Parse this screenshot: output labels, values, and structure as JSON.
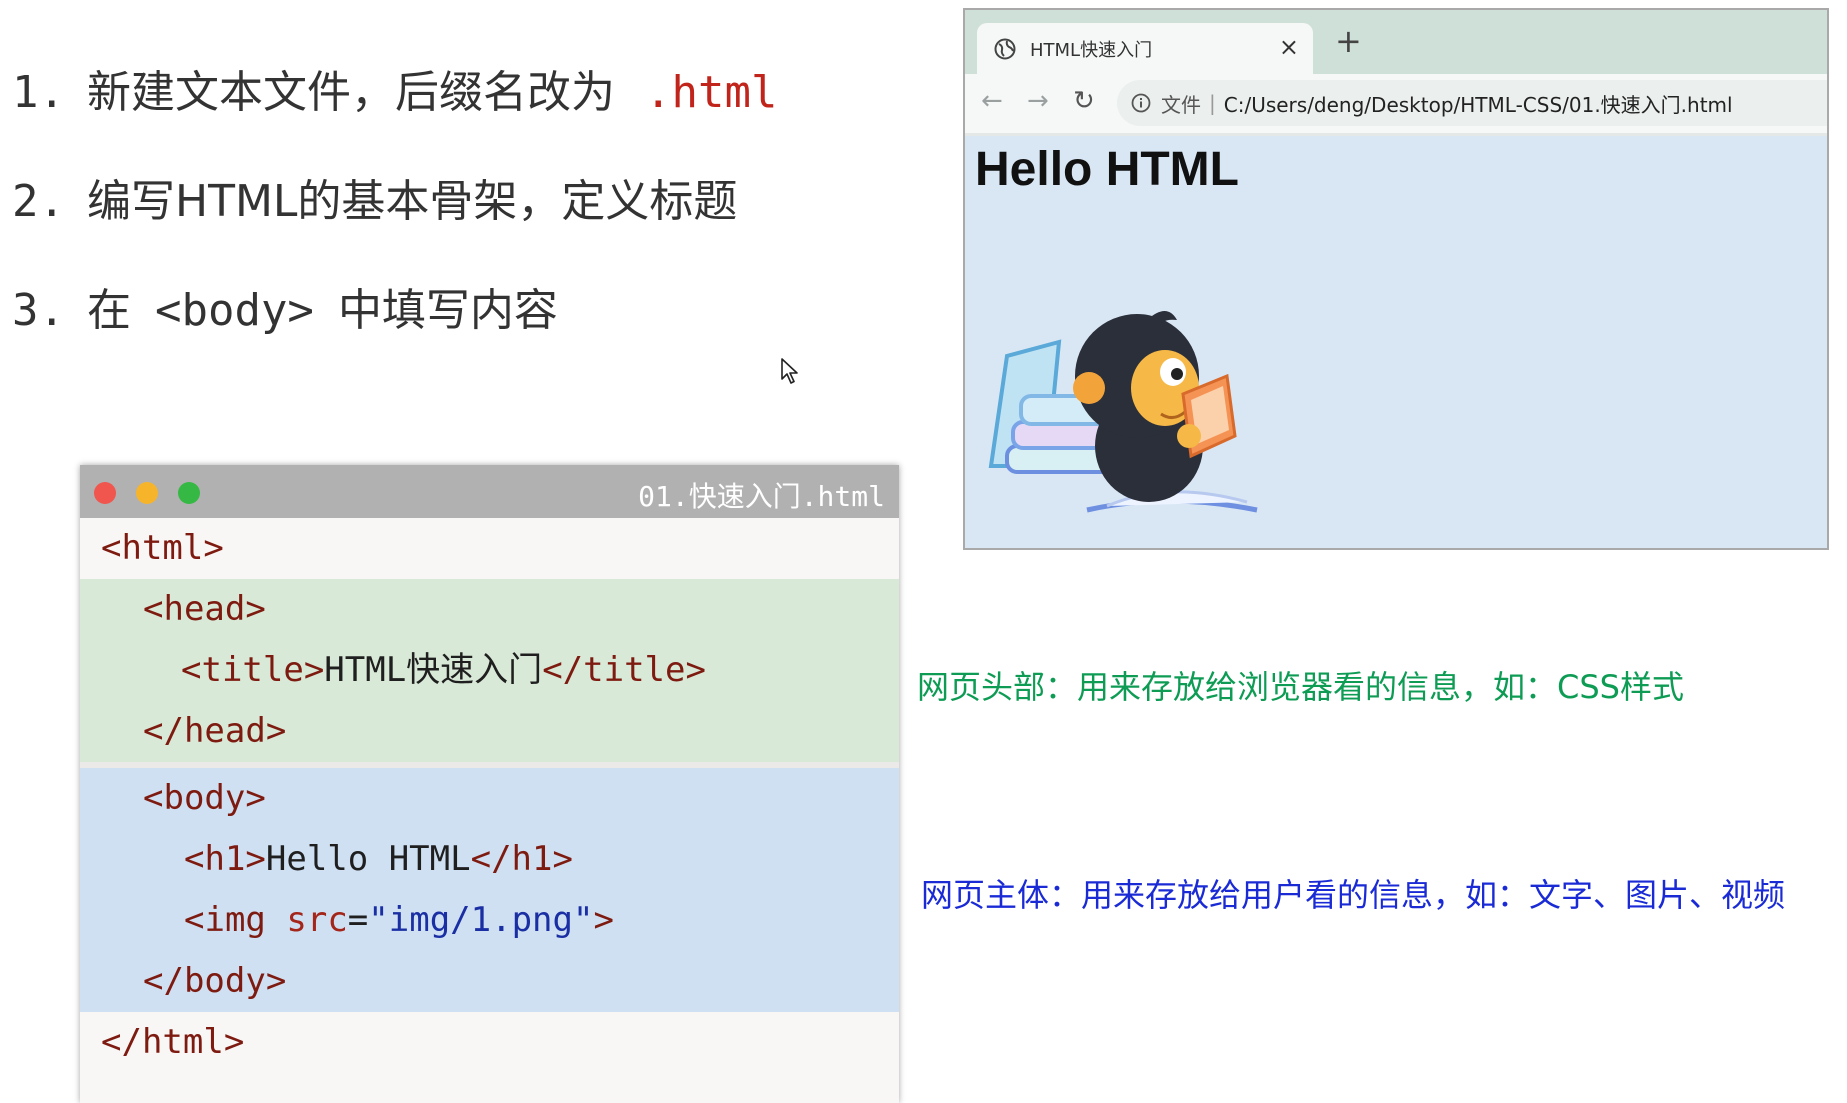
{
  "steps": [
    {
      "num": "1.",
      "text": "新建文本文件，后缀名改为",
      "code": ".html"
    },
    {
      "num": "2.",
      "text": "编写HTML的基本骨架，定义标题"
    },
    {
      "num": "3.",
      "pre": "在",
      "code": "<body>",
      "post": "中填写内容"
    }
  ],
  "editor": {
    "filename": "01.快速入门.html",
    "lines": {
      "html_open": "<html>",
      "head_open": "<head>",
      "title_open": "<title>",
      "title_text": "HTML快速入门",
      "title_close": "</title>",
      "head_close": "</head>",
      "body_open": "<body>",
      "h1_open": "<h1>",
      "h1_text": "Hello HTML",
      "h1_close": "</h1>",
      "img_open": "<img",
      "img_attr": "src",
      "img_eq": "=",
      "img_value": "\"img/1.png\"",
      "img_close": ">",
      "body_close": "</body>",
      "html_close": "</html>"
    }
  },
  "browser": {
    "tab_title": "HTML快速入门",
    "tab_close": "×",
    "new_tab": "+",
    "nav_back": "←",
    "nav_forward": "→",
    "nav_reload": "↻",
    "url_label": "文件",
    "url_separator": "|",
    "url": "C:/Users/deng/Desktop/HTML-CSS/01.快速入门.html",
    "page_heading": "Hello HTML",
    "page_image": "mascot-reading-books-illustration"
  },
  "annotations": {
    "head": "网页头部：用来存放给浏览器看的信息，如：CSS样式",
    "body": "网页主体：用来存放给用户看的信息，如：文字、图片、视频"
  },
  "colors": {
    "accent_red": "#c0241b",
    "head_highlight": "#d9e9d7",
    "body_highlight": "#cfe0f2",
    "head_annotation": "#0e9c55",
    "body_annotation": "#1a2bd6"
  }
}
